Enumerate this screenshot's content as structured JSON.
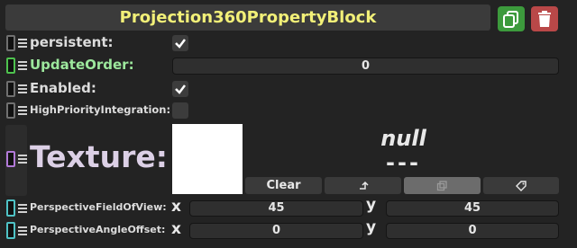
{
  "header": {
    "title": "Projection360PropertyBlock",
    "copy_icon": "copy-icon",
    "delete_icon": "trash-icon",
    "colors": {
      "title": "#f2f078",
      "copy": "#3c9a3c",
      "delete": "#b94848"
    }
  },
  "properties": {
    "persistent": {
      "label": "persistent:",
      "checked": true
    },
    "update_order": {
      "label": "UpdateOrder:",
      "value": "0"
    },
    "enabled": {
      "label": "Enabled:",
      "checked": true
    },
    "high_priority": {
      "label": "HighPriorityIntegration:",
      "checked": false
    },
    "texture": {
      "label": "Texture:",
      "null_text": "null",
      "dash_text": "---",
      "clear_label": "Clear",
      "buttons": {
        "assign_icon": "arrow-up-icon",
        "copy_icon": "copy-icon",
        "tag_icon": "tag-icon"
      }
    },
    "fov": {
      "label": "PerspectiveFieldOfView:",
      "x_label": "x",
      "x": "45",
      "y_label": "y",
      "y": "45"
    },
    "angle_offset": {
      "label": "PerspectiveAngleOffset:",
      "x_label": "x",
      "x": "0",
      "y_label": "y",
      "y": "0"
    }
  }
}
